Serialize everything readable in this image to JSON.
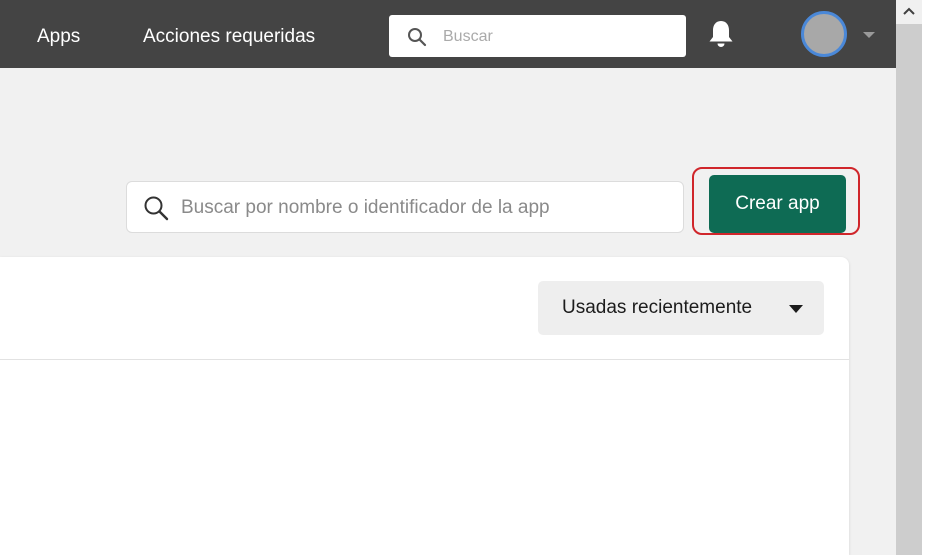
{
  "topbar": {
    "nav": [
      {
        "label": "Apps"
      },
      {
        "label": "Acciones requeridas"
      }
    ],
    "search": {
      "placeholder": "Buscar",
      "icon": "search-icon"
    },
    "notifications_icon": "bell-icon",
    "avatar_icon": "avatar",
    "menu_caret_icon": "caret-down-icon",
    "background": "#444444"
  },
  "main": {
    "app_search": {
      "placeholder": "Buscar por nombre o identificador de la app",
      "icon": "search-icon"
    },
    "create_button": {
      "label": "Crear app",
      "color": "#0e6b54"
    },
    "highlight_color": "#d0262b"
  },
  "apps_panel": {
    "sort": {
      "label": "Usadas recientemente",
      "icon": "caret-down-icon"
    }
  },
  "scrollbar": {
    "up_icon": "chevron-up-icon"
  }
}
